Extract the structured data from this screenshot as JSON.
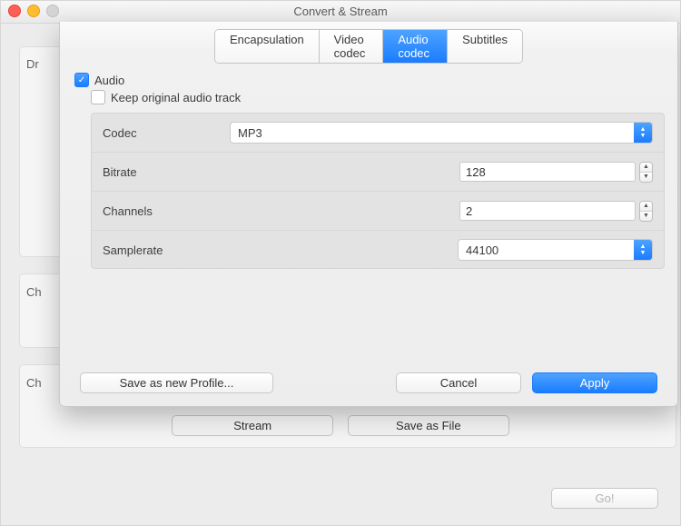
{
  "window": {
    "title": "Convert & Stream"
  },
  "back": {
    "label1": "Dr",
    "label2": "Ch",
    "label3": "Ch",
    "stream_btn": "Stream",
    "save_file_btn": "Save as File",
    "go_btn": "Go!"
  },
  "tabs": {
    "encapsulation": "Encapsulation",
    "video": "Video codec",
    "audio": "Audio codec",
    "subtitles": "Subtitles"
  },
  "audio": {
    "enable_label": "Audio",
    "keep_label": "Keep original audio track",
    "codec_label": "Codec",
    "codec_value": "MP3",
    "bitrate_label": "Bitrate",
    "bitrate_value": "128",
    "channels_label": "Channels",
    "channels_value": "2",
    "samplerate_label": "Samplerate",
    "samplerate_value": "44100"
  },
  "footer": {
    "save_profile": "Save as new Profile...",
    "cancel": "Cancel",
    "apply": "Apply"
  }
}
